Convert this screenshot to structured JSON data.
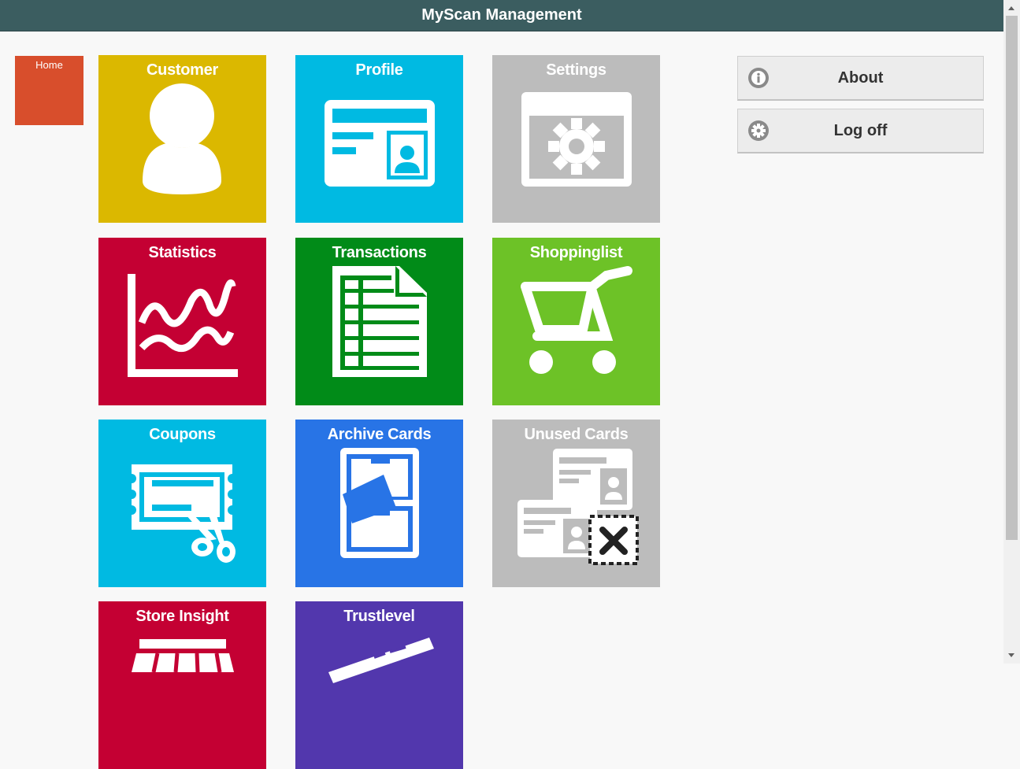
{
  "header": {
    "title": "MyScan Management"
  },
  "home": {
    "label": "Home"
  },
  "tiles": [
    {
      "label": "Customer",
      "color": "#dbb800",
      "icon": "person-icon"
    },
    {
      "label": "Profile",
      "color": "#00bae2",
      "icon": "id-card-icon"
    },
    {
      "label": "Settings",
      "color": "#bcbcbc",
      "icon": "settings-window-icon"
    },
    {
      "label": "Statistics",
      "color": "#c40033",
      "icon": "statistics-chart-icon"
    },
    {
      "label": "Transactions",
      "color": "#018b18",
      "icon": "ledger-document-icon"
    },
    {
      "label": "Shoppinglist",
      "color": "#6dc227",
      "icon": "shopping-cart-icon"
    },
    {
      "label": "Coupons",
      "color": "#00bae2",
      "icon": "coupon-scissors-icon"
    },
    {
      "label": "Archive Cards",
      "color": "#2874e6",
      "icon": "filing-cabinet-icon"
    },
    {
      "label": "Unused Cards",
      "color": "#bcbcbc",
      "icon": "unused-cards-icon"
    },
    {
      "label": "Store Insight",
      "color": "#c40033",
      "icon": "storefront-icon"
    },
    {
      "label": "Trustlevel",
      "color": "#5237ad",
      "icon": "trustlevel-icon"
    }
  ],
  "side_buttons": {
    "about": {
      "label": "About",
      "icon": "info-icon"
    },
    "logoff": {
      "label": "Log off",
      "icon": "gear-icon"
    }
  }
}
